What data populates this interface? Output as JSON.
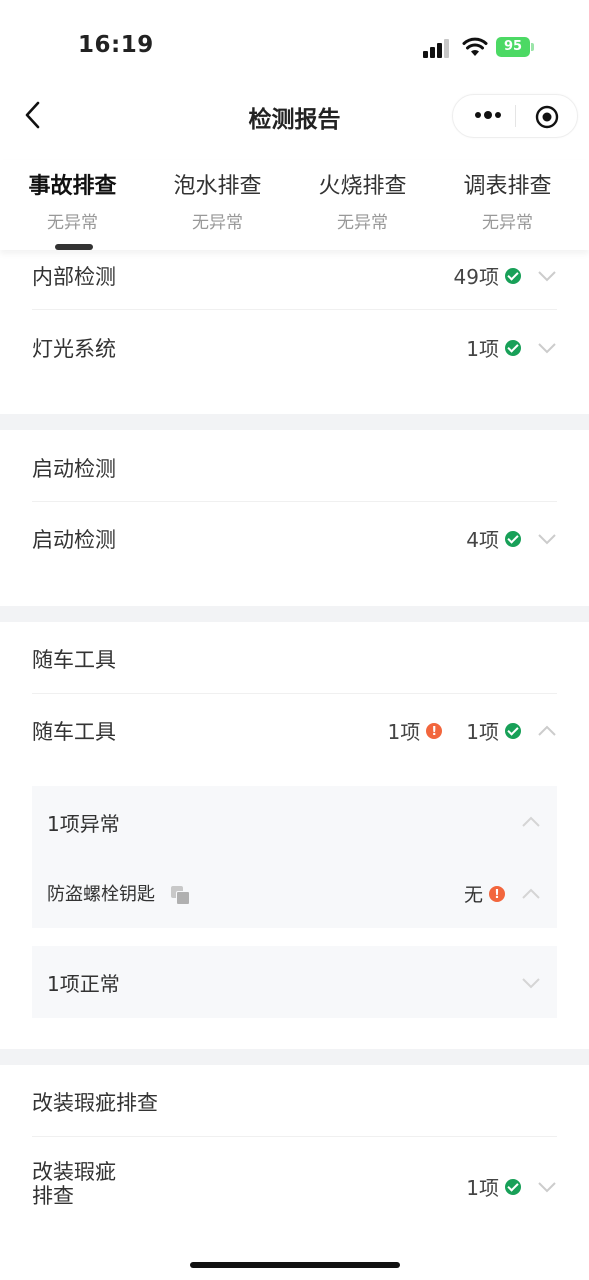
{
  "status": {
    "time": "16:19",
    "battery": "95"
  },
  "nav": {
    "title": "检测报告"
  },
  "tabs": [
    {
      "label": "事故排查",
      "status": "无异常"
    },
    {
      "label": "泡水排查",
      "status": "无异常"
    },
    {
      "label": "火烧排查",
      "status": "无异常"
    },
    {
      "label": "调表排查",
      "status": "无异常"
    }
  ],
  "rows": {
    "interior": {
      "label": "内部检测",
      "ok_count": "49项"
    },
    "lighting": {
      "label": "灯光系统",
      "ok_count": "1项"
    },
    "startup_title": "启动检测",
    "startup": {
      "label": "启动检测",
      "ok_count": "4项"
    },
    "tools_title": "随车工具",
    "tools": {
      "label": "随车工具",
      "err_count": "1项",
      "ok_count": "1项"
    },
    "tools_abnormal": {
      "label": "1项异常"
    },
    "tools_item": {
      "label": "防盗螺栓钥匙",
      "value": "无"
    },
    "tools_normal": {
      "label": "1项正常"
    },
    "mod_title": "改装瑕疵排查",
    "mod": {
      "label_line1": "改装瑕疵",
      "label_line2": "排查",
      "ok_count": "1项"
    }
  },
  "colors": {
    "ok": "#18a058",
    "error": "#f2663d",
    "battery": "#4cd964"
  }
}
